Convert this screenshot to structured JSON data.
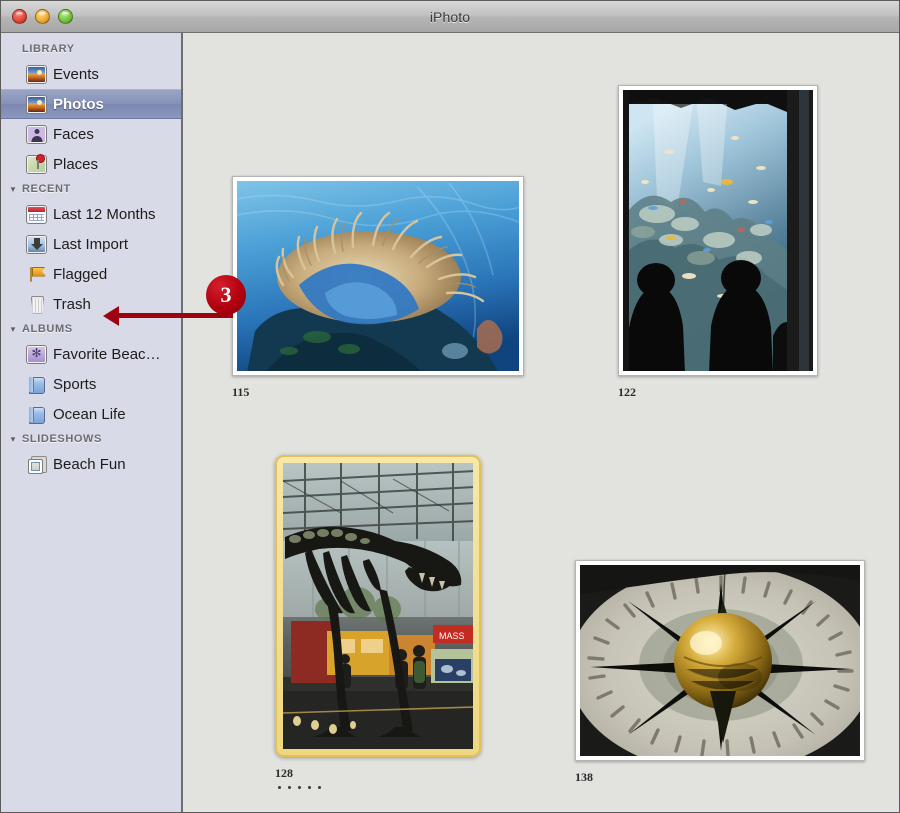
{
  "window": {
    "title": "iPhoto",
    "traffic_lights": [
      "close-button",
      "minimize-button",
      "zoom-button"
    ]
  },
  "sidebar": {
    "sections": [
      {
        "title": "LIBRARY",
        "has_disclosure": false,
        "items": [
          {
            "label": "Events",
            "icon": "events-photo-icon",
            "selected": false
          },
          {
            "label": "Photos",
            "icon": "photos-photo-icon",
            "selected": true
          },
          {
            "label": "Faces",
            "icon": "faces-person-icon",
            "selected": false
          },
          {
            "label": "Places",
            "icon": "places-map-pin-icon",
            "selected": false
          }
        ]
      },
      {
        "title": "RECENT",
        "has_disclosure": true,
        "items": [
          {
            "label": "Last 12 Months",
            "icon": "calendar-icon",
            "selected": false
          },
          {
            "label": "Last Import",
            "icon": "import-arrow-icon",
            "selected": false
          },
          {
            "label": "Flagged",
            "icon": "flag-icon",
            "selected": false
          },
          {
            "label": "Trash",
            "icon": "trash-icon",
            "selected": false
          }
        ]
      },
      {
        "title": "ALBUMS",
        "has_disclosure": true,
        "items": [
          {
            "label": "Favorite Beac…",
            "icon": "smart-album-icon",
            "selected": false
          },
          {
            "label": "Sports",
            "icon": "album-book-icon",
            "selected": false
          },
          {
            "label": "Ocean Life",
            "icon": "album-book-icon",
            "selected": false
          }
        ]
      },
      {
        "title": "SLIDESHOWS",
        "has_disclosure": true,
        "items": [
          {
            "label": "Beach Fun",
            "icon": "slideshow-icon",
            "selected": false
          }
        ]
      }
    ]
  },
  "main": {
    "photos": [
      {
        "caption": "115",
        "subject": "underwater-coral-anemone",
        "selected": false,
        "rating_dots": 0
      },
      {
        "caption": "122",
        "subject": "aquarium-tank-visitors",
        "selected": false,
        "rating_dots": 0
      },
      {
        "caption": "128",
        "subject": "dinosaur-skeleton-museum",
        "selected": true,
        "rating_dots": 5
      },
      {
        "caption": "138",
        "subject": "foucault-pendulum-compass",
        "selected": false,
        "rating_dots": 0
      }
    ]
  },
  "callout": {
    "number": "3",
    "points_to": "Trash",
    "color": "#9d0310"
  }
}
